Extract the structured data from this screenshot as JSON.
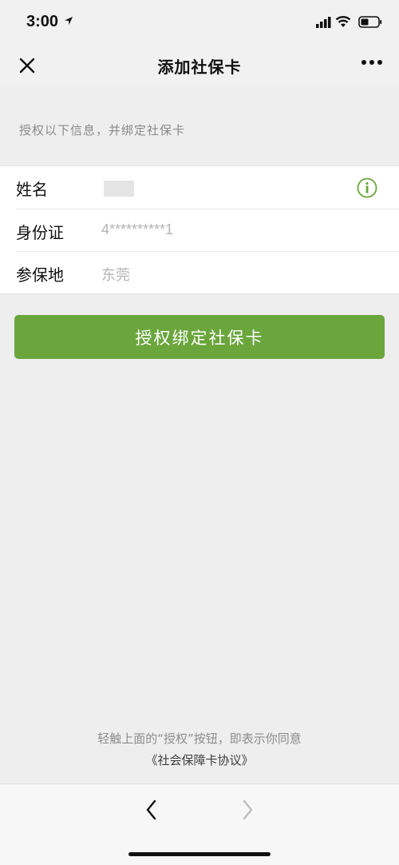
{
  "status_bar": {
    "time": "3:00",
    "icons": [
      "location-arrow-icon",
      "cellular-signal-icon",
      "wifi-icon",
      "battery-icon"
    ]
  },
  "nav": {
    "title": "添加社保卡",
    "close_icon": "close-icon",
    "more_icon": "more-icon"
  },
  "hint": "授权以下信息，并绑定社保卡",
  "form": {
    "rows": [
      {
        "label": "姓名",
        "value": ""
      },
      {
        "label": "身份证",
        "value": "4**********1"
      },
      {
        "label": "参保地",
        "value": "东莞"
      }
    ],
    "info_icon": "info-icon"
  },
  "primary_button": {
    "label": "授权绑定社保卡"
  },
  "agreement": {
    "text": "轻触上面的“授权”按钮，即表示你同意",
    "link": "《社会保障卡协议》"
  },
  "bottom_nav": {
    "back_icon": "chevron-left-icon",
    "forward_icon": "chevron-right-icon"
  },
  "colors": {
    "accent": "#6aa63c",
    "background": "#efeeef"
  }
}
